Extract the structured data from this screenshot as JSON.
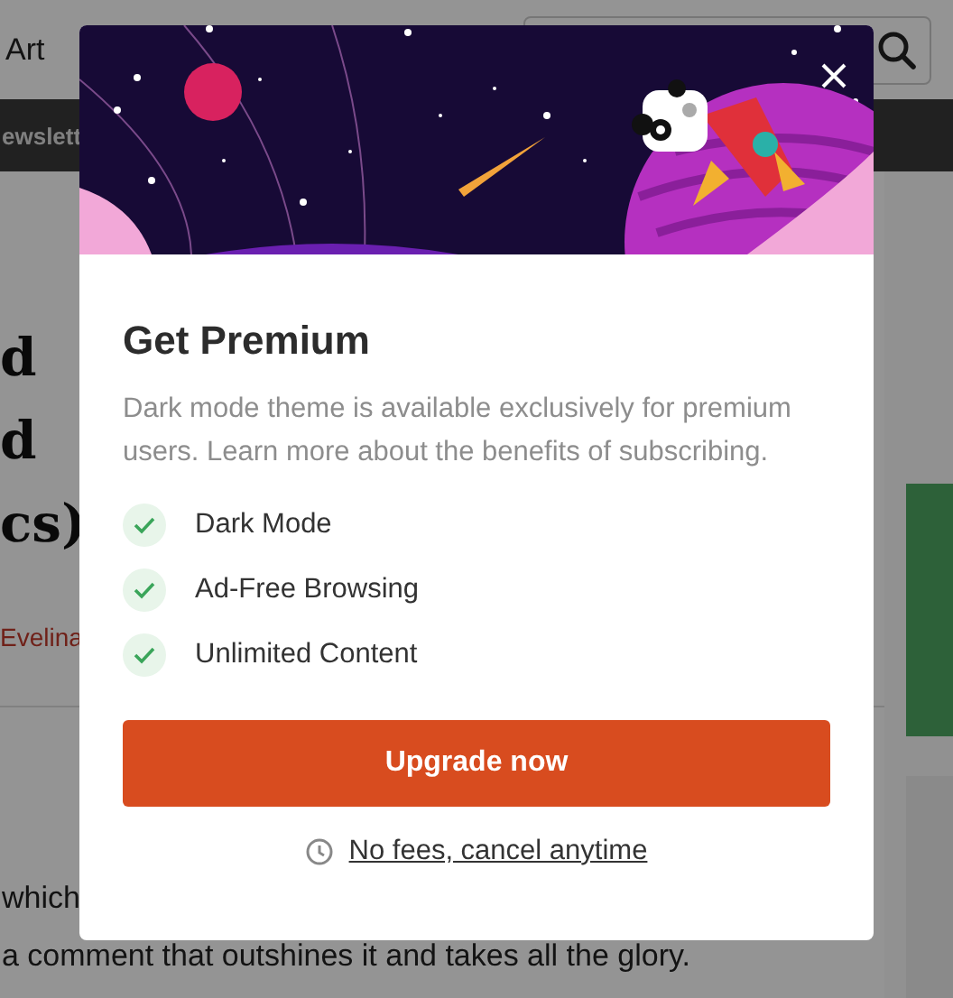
{
  "page": {
    "header_link": "Art",
    "nav_item": "ewslett",
    "title_lines": [
      "d",
      "d",
      "cs)"
    ],
    "author": "Evelina",
    "body_lines": [
      "which",
      "a comment that outshines it and takes all the glory."
    ]
  },
  "modal": {
    "title": "Get Premium",
    "description": "Dark mode theme is available exclusively for premium users. Learn more about the benefits of subscribing.",
    "features": [
      {
        "label": "Dark Mode",
        "checked": true
      },
      {
        "label": "Ad-Free Browsing",
        "checked": true
      },
      {
        "label": "Unlimited Content",
        "checked": true
      }
    ],
    "button": "Upgrade now",
    "note": "No fees, cancel anytime"
  }
}
